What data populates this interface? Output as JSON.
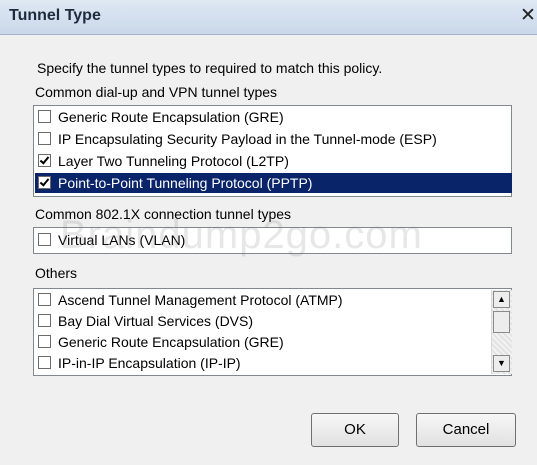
{
  "window": {
    "title": "Tunnel Type",
    "close_glyph": "✕"
  },
  "intro": "Specify the tunnel types to required to match this policy.",
  "groups": {
    "dialup": {
      "label": "Common dial-up and VPN tunnel types",
      "items": [
        {
          "label": "Generic Route Encapsulation (GRE)",
          "checked": false,
          "selected": false
        },
        {
          "label": "IP Encapsulating Security Payload in the Tunnel-mode (ESP)",
          "checked": false,
          "selected": false
        },
        {
          "label": "Layer Two Tunneling Protocol (L2TP)",
          "checked": true,
          "selected": false
        },
        {
          "label": "Point-to-Point Tunneling Protocol (PPTP)",
          "checked": true,
          "selected": true
        }
      ]
    },
    "dot1x": {
      "label": "Common 802.1X connection tunnel types",
      "items": [
        {
          "label": "Virtual LANs (VLAN)",
          "checked": false,
          "selected": false
        }
      ]
    },
    "others": {
      "label": "Others",
      "items": [
        {
          "label": "Ascend Tunnel Management Protocol (ATMP)",
          "checked": false,
          "selected": false
        },
        {
          "label": "Bay Dial Virtual Services (DVS)",
          "checked": false,
          "selected": false
        },
        {
          "label": "Generic Route Encapsulation (GRE)",
          "checked": false,
          "selected": false
        },
        {
          "label": "IP-in-IP Encapsulation (IP-IP)",
          "checked": false,
          "selected": false
        }
      ]
    }
  },
  "watermark": "Braindump2go.com",
  "buttons": {
    "ok": "OK",
    "cancel": "Cancel"
  },
  "colors": {
    "selection": "#0a246a",
    "titlebar": "#c9d8ea"
  }
}
